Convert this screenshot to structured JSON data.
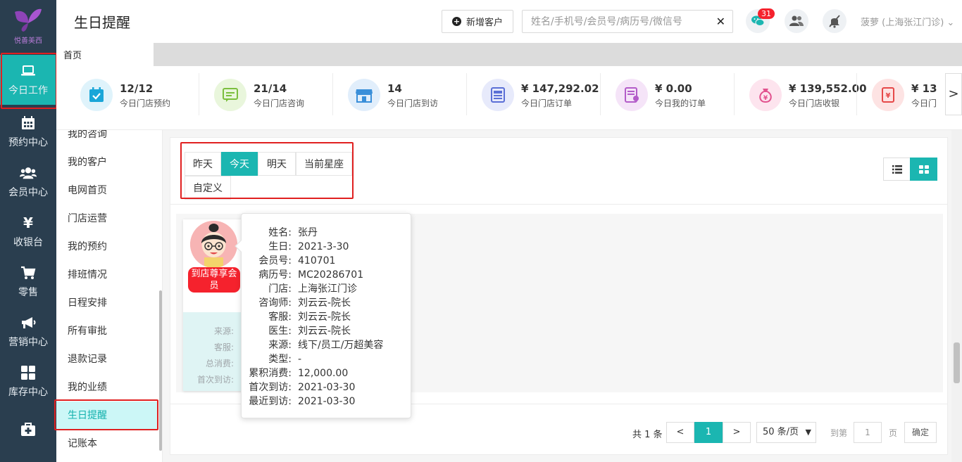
{
  "brand": {
    "logo_text": "悦善美西"
  },
  "leftnav": [
    {
      "label": "今日工作",
      "icon": "laptop-icon",
      "active": true
    },
    {
      "label": "预约中心",
      "icon": "calendar-icon"
    },
    {
      "label": "会员中心",
      "icon": "users-icon"
    },
    {
      "label": "收银台",
      "icon": "yen-icon"
    },
    {
      "label": "零售",
      "icon": "cart-icon"
    },
    {
      "label": "营销中心",
      "icon": "megaphone-icon"
    },
    {
      "label": "库存中心",
      "icon": "grid-icon"
    },
    {
      "label": "",
      "icon": "medkit-icon"
    }
  ],
  "header": {
    "title": "生日提醒",
    "new_customer": "新增客户",
    "search_placeholder": "姓名/手机号/会员号/病历号/微信号",
    "chat_badge": "31",
    "user": "菠萝 (上海张江门诊)"
  },
  "tabs": [
    {
      "label": "首页"
    }
  ],
  "stats": [
    {
      "value": "12/12",
      "label": "今日门店预约",
      "icon": "calendar-check-icon",
      "color": "#1aa6d8",
      "bg": "#dff3fb"
    },
    {
      "value": "21/14",
      "label": "今日门店咨询",
      "icon": "consult-icon",
      "color": "#7bbf3e",
      "bg": "#e9f6dc"
    },
    {
      "value": "14",
      "label": "今日门店到访",
      "icon": "store-icon",
      "color": "#3a8fd9",
      "bg": "#e1eefb"
    },
    {
      "value": "¥ 147,292.02",
      "label": "今日门店订单",
      "icon": "news-icon",
      "color": "#5b6fd6",
      "bg": "#e7eafb"
    },
    {
      "value": "¥ 0.00",
      "label": "今日我的订单",
      "icon": "order-user-icon",
      "color": "#b35cc9",
      "bg": "#f5e4f8"
    },
    {
      "value": "¥ 139,552.00",
      "label": "今日门店收银",
      "icon": "money-bag-icon",
      "color": "#e2528e",
      "bg": "#fde4ee"
    },
    {
      "value": "¥ 13",
      "label": "今日门",
      "icon": "receipt-icon",
      "color": "#e64848",
      "bg": "#fde3e3"
    }
  ],
  "subnav": [
    {
      "label": "我的咨询"
    },
    {
      "label": "我的客户"
    },
    {
      "label": "电网首页"
    },
    {
      "label": "门店运营"
    },
    {
      "label": "我的预约"
    },
    {
      "label": "排班情况"
    },
    {
      "label": "日程安排"
    },
    {
      "label": "所有审批"
    },
    {
      "label": "退款记录"
    },
    {
      "label": "我的业绩"
    },
    {
      "label": "生日提醒",
      "active": true
    },
    {
      "label": "记账本"
    }
  ],
  "filters": {
    "yesterday": "昨天",
    "today": "今天",
    "tomorrow": "明天",
    "constellation": "当前星座",
    "custom": "自定义"
  },
  "card": {
    "tag": "到店尊享会员",
    "rows": [
      "来源:",
      "客服:",
      "总消费:",
      "首次到访:"
    ]
  },
  "popover": [
    {
      "k": "姓名:",
      "v": "张丹"
    },
    {
      "k": "生日:",
      "v": "2021-3-30"
    },
    {
      "k": "会员号:",
      "v": "410701"
    },
    {
      "k": "病历号:",
      "v": "MC20286701"
    },
    {
      "k": "门店:",
      "v": "上海张江门诊"
    },
    {
      "k": "咨询师:",
      "v": "刘云云-院长"
    },
    {
      "k": "客服:",
      "v": "刘云云-院长"
    },
    {
      "k": "医生:",
      "v": "刘云云-院长"
    },
    {
      "k": "来源:",
      "v": "线下/员工/万超美容"
    },
    {
      "k": "类型:",
      "v": "-"
    },
    {
      "k": "累积消费:",
      "v": "12,000.00"
    },
    {
      "k": "首次到访:",
      "v": "2021-03-30"
    },
    {
      "k": "最近到访:",
      "v": "2021-03-30"
    }
  ],
  "pager": {
    "total": "共 1 条",
    "prev": "<",
    "current": "1",
    "next": ">",
    "size": "50 条/页",
    "goto": "到第",
    "goto_value": "1",
    "page": "页",
    "ok": "确定"
  }
}
